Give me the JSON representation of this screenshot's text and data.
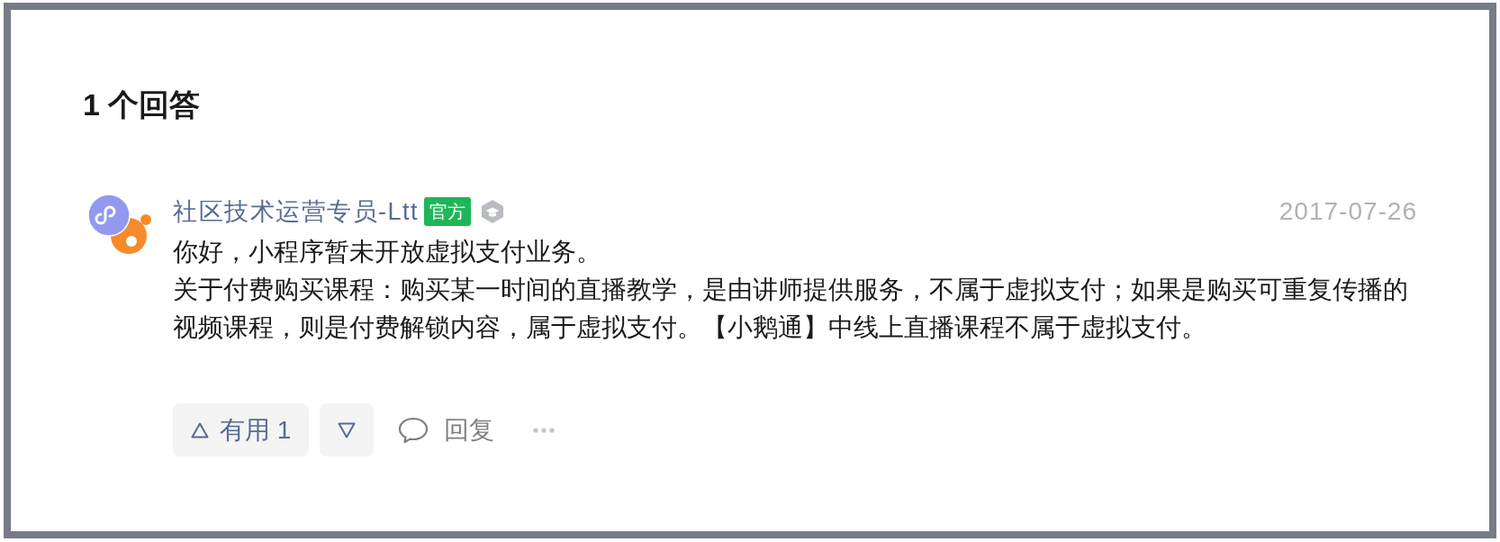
{
  "heading": "1 个回答",
  "answers": [
    {
      "author": {
        "name": "社区技术运营专员-Ltt",
        "badge": "官方"
      },
      "date": "2017-07-26",
      "paragraphs": [
        "你好，小程序暂未开放虚拟支付业务。",
        "关于付费购买课程：购买某一时间的直播教学，是由讲师提供服务，不属于虚拟支付；如果是购买可重复传播的视频课程，则是付费解锁内容，属于虚拟支付。【小鹅通】中线上直播课程不属于虚拟支付。"
      ],
      "actions": [
        {
          "kind": "upvote",
          "label": "有用 1"
        },
        {
          "kind": "downvote"
        },
        {
          "kind": "reply",
          "label": "回复"
        },
        {
          "kind": "more"
        }
      ]
    }
  ]
}
